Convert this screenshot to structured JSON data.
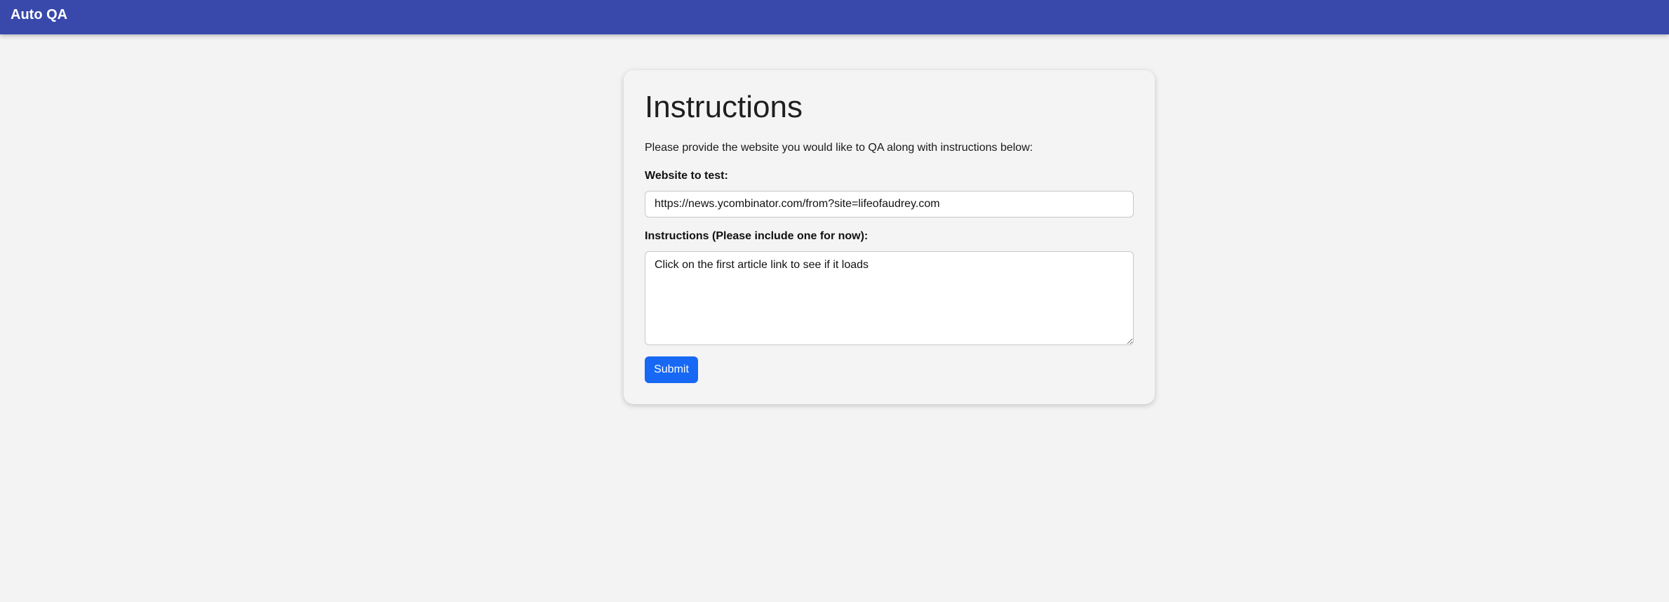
{
  "header": {
    "app_title": "Auto QA",
    "bar_color": "#3949ab"
  },
  "form": {
    "heading": "Instructions",
    "intro": "Please provide the website you would like to QA along with instructions below:",
    "website_label": "Website to test:",
    "website_value": "https://news.ycombinator.com/from?site=lifeofaudrey.com",
    "instructions_label": "Instructions (Please include one for now):",
    "instructions_value": "Click on the first article link to see if it loads",
    "submit_label": "Submit",
    "submit_color": "#1668f5"
  }
}
